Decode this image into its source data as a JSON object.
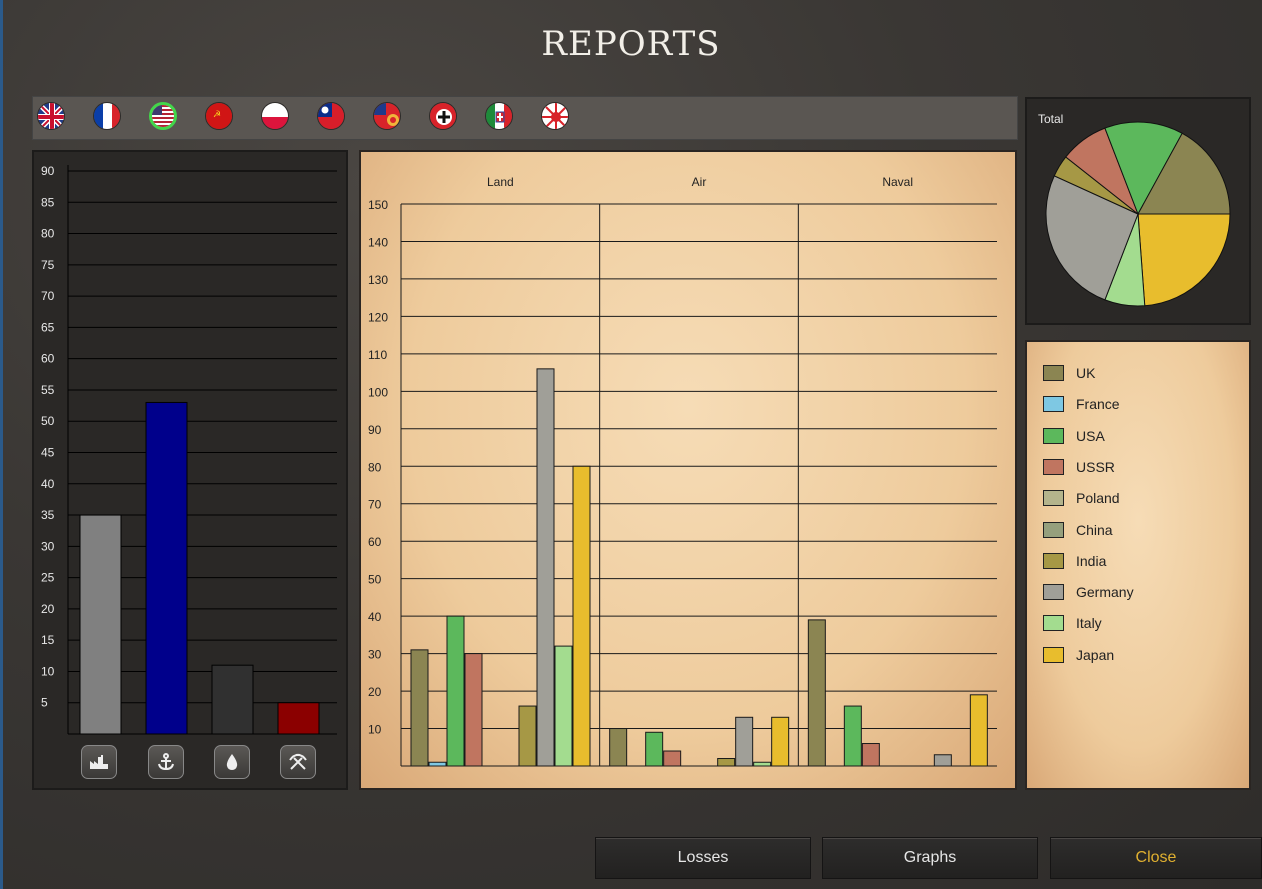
{
  "header": {
    "title": "REPORTS"
  },
  "flags": [
    {
      "name": "UK",
      "selected": false
    },
    {
      "name": "France",
      "selected": false
    },
    {
      "name": "USA",
      "selected": true
    },
    {
      "name": "USSR",
      "selected": false
    },
    {
      "name": "Poland",
      "selected": false
    },
    {
      "name": "China",
      "selected": false
    },
    {
      "name": "India",
      "selected": false
    },
    {
      "name": "Germany",
      "selected": false
    },
    {
      "name": "Italy",
      "selected": false
    },
    {
      "name": "Japan",
      "selected": false
    }
  ],
  "left_chart": {
    "type": "bar",
    "yticks": [
      90,
      85,
      80,
      75,
      70,
      65,
      60,
      55,
      50,
      45,
      40,
      35,
      30,
      25,
      20,
      15,
      10,
      5
    ],
    "ylim": [
      0,
      90
    ],
    "bars": [
      {
        "value": 35,
        "color": "#808080"
      },
      {
        "value": 53,
        "color": "#00008b"
      },
      {
        "value": 11,
        "color": "#303030"
      },
      {
        "value": 5,
        "color": "#8b0000"
      }
    ],
    "icons": [
      "factory-icon",
      "anchor-icon",
      "oil-drop-icon",
      "mining-icon"
    ]
  },
  "main_chart": {
    "chart_data": {
      "type": "bar",
      "categories": [
        "Land",
        "Air",
        "Naval"
      ],
      "ylim": [
        0,
        150
      ],
      "yticks": [
        150,
        140,
        130,
        120,
        110,
        100,
        90,
        80,
        70,
        60,
        50,
        40,
        30,
        20,
        10
      ],
      "series": [
        {
          "name": "UK",
          "color": "#8b8552",
          "values": [
            31,
            10,
            39
          ]
        },
        {
          "name": "France",
          "color": "#7ec8e3",
          "values": [
            1,
            0,
            0
          ]
        },
        {
          "name": "USA",
          "color": "#5cb85c",
          "values": [
            40,
            9,
            16
          ]
        },
        {
          "name": "USSR",
          "color": "#c07560",
          "values": [
            30,
            4,
            6
          ]
        },
        {
          "name": "Poland",
          "color": "#b4b48c",
          "values": [
            0,
            0,
            0
          ]
        },
        {
          "name": "China",
          "color": "#96a07d",
          "values": [
            0,
            0,
            0
          ]
        },
        {
          "name": "India",
          "color": "#a69845",
          "values": [
            16,
            2,
            0
          ]
        },
        {
          "name": "Germany",
          "color": "#a09f98",
          "values": [
            106,
            13,
            3
          ]
        },
        {
          "name": "Italy",
          "color": "#a3dc8f",
          "values": [
            32,
            1,
            0
          ]
        },
        {
          "name": "Japan",
          "color": "#e8bd2d",
          "values": [
            80,
            13,
            19
          ]
        }
      ]
    }
  },
  "pie": {
    "title": "Total",
    "chart_data": {
      "type": "pie",
      "slices": [
        {
          "name": "Japan",
          "value": 112,
          "color": "#e8bd2d"
        },
        {
          "name": "Italy",
          "value": 33,
          "color": "#a3dc8f"
        },
        {
          "name": "Germany",
          "value": 122,
          "color": "#a09f98"
        },
        {
          "name": "India",
          "value": 18,
          "color": "#a69845"
        },
        {
          "name": "USSR",
          "value": 40,
          "color": "#c07560"
        },
        {
          "name": "USA",
          "value": 65,
          "color": "#5cb85c"
        },
        {
          "name": "UK",
          "value": 80,
          "color": "#8b8552"
        }
      ]
    }
  },
  "legend": [
    {
      "name": "UK",
      "color": "#8b8552"
    },
    {
      "name": "France",
      "color": "#7ec8e3"
    },
    {
      "name": "USA",
      "color": "#5cb85c"
    },
    {
      "name": "USSR",
      "color": "#c07560"
    },
    {
      "name": "Poland",
      "color": "#b4b48c"
    },
    {
      "name": "China",
      "color": "#96a07d"
    },
    {
      "name": "India",
      "color": "#a69845"
    },
    {
      "name": "Germany",
      "color": "#a09f98"
    },
    {
      "name": "Italy",
      "color": "#a3dc8f"
    },
    {
      "name": "Japan",
      "color": "#e8bd2d"
    }
  ],
  "buttons": {
    "losses": "Losses",
    "graphs": "Graphs",
    "close": "Close",
    "close_color": "#e0b030"
  }
}
